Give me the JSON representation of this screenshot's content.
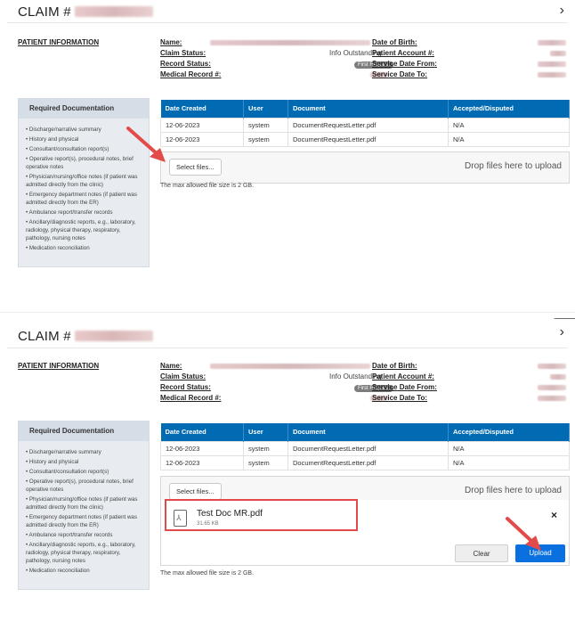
{
  "panels": [
    {
      "claim_prefix": "CLAIM #",
      "close_glyph": "›",
      "patient_info_label": "PATIENT INFORMATION",
      "labels": {
        "name": "Name:",
        "claim_status": "Claim Status:",
        "record_status": "Record Status:",
        "medical_record": "Medical Record #:",
        "dob": "Date of Birth:",
        "patient_account": "Patient Account #:",
        "service_from": "Service Date From:",
        "service_to": "Service Date To:"
      },
      "values": {
        "claim_status": "Info Outstanding",
        "record_status": "First Request"
      },
      "docs_header": "Required Documentation",
      "docs": [
        "Discharge/narrative summary",
        "History and physical",
        "Consultant/consultation report(s)",
        "Operative report(s), procedural notes, brief operative notes",
        "Physician/nursing/office notes (if patient was admitted directly from the clinic)",
        "Emergency department notes (if patient was admitted directly from the ER)",
        "Ambulance report/transfer records",
        "Ancillary/diagnostic reports, e.g., laboratory, radiology, physical therapy, respiratory, pathology, nursing notes",
        "Medication reconciliation"
      ],
      "table": {
        "headers": [
          "Date Created",
          "User",
          "Document",
          "Accepted/Disputed"
        ],
        "rows": [
          [
            "12-06-2023",
            "system",
            "DocumentRequestLetter.pdf",
            "N/A"
          ],
          [
            "12-06-2023",
            "system",
            "DocumentRequestLetter.pdf",
            "N/A"
          ]
        ]
      },
      "select_files": "Select files...",
      "drop_text": "Drop files here to upload",
      "max_note": "The max allowed file size is 2 GB."
    },
    {
      "claim_prefix": "CLAIM #",
      "close_glyph": "›",
      "patient_info_label": "PATIENT INFORMATION",
      "labels": {
        "name": "Name:",
        "claim_status": "Claim Status:",
        "record_status": "Record Status:",
        "medical_record": "Medical Record #:",
        "dob": "Date of Birth:",
        "patient_account": "Patient Account #:",
        "service_from": "Service Date From:",
        "service_to": "Service Date To:"
      },
      "values": {
        "claim_status": "Info Outstanding",
        "record_status": "First Request"
      },
      "docs_header": "Required Documentation",
      "docs": [
        "Discharge/narrative summary",
        "History and physical",
        "Consultant/consultation report(s)",
        "Operative report(s), procedural notes, brief operative notes",
        "Physician/nursing/office notes (if patient was admitted directly from the clinic)",
        "Emergency department notes (if patient was admitted directly from the ER)",
        "Ambulance report/transfer records",
        "Ancillary/diagnostic reports, e.g., laboratory, radiology, physical therapy, respiratory, pathology, nursing notes",
        "Medication reconciliation"
      ],
      "table": {
        "headers": [
          "Date Created",
          "User",
          "Document",
          "Accepted/Disputed"
        ],
        "rows": [
          [
            "12-06-2023",
            "system",
            "DocumentRequestLetter.pdf",
            "N/A"
          ],
          [
            "12-06-2023",
            "system",
            "DocumentRequestLetter.pdf",
            "N/A"
          ]
        ]
      },
      "select_files": "Select files...",
      "drop_text": "Drop files here to upload",
      "max_note": "The max allowed file size is 2 GB.",
      "file": {
        "name": "Test Doc MR.pdf",
        "size": "31.65 KB",
        "remove_glyph": "×"
      },
      "clear": "Clear",
      "upload": "Upload"
    }
  ],
  "colors": {
    "accent": "#006bb3",
    "upload": "#0a6fdf",
    "arrow": "#e34a4a"
  },
  "icons": [
    "pdf-file-icon",
    "close-icon",
    "remove-file-icon",
    "annotation-arrow"
  ]
}
